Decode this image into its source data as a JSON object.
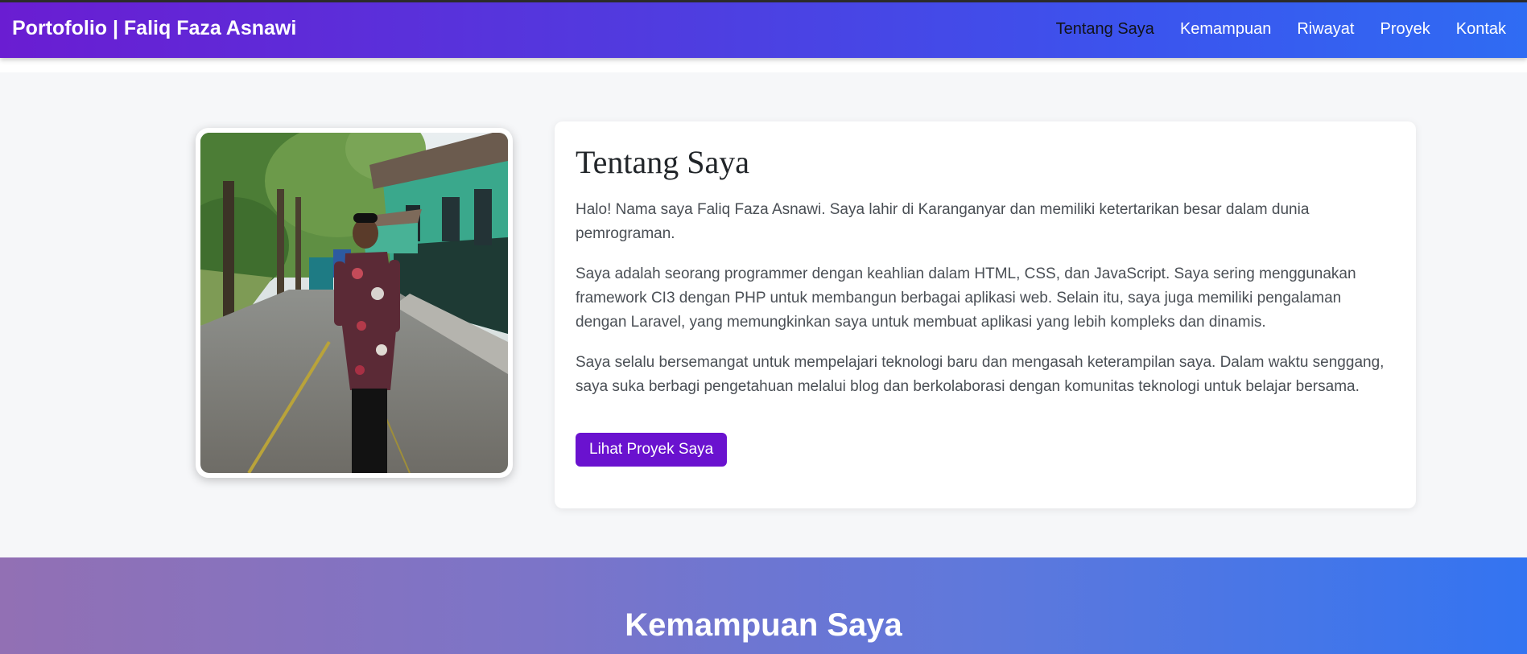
{
  "navbar": {
    "brand": "Portofolio | Faliq Faza Asnawi",
    "links": [
      {
        "label": "Tentang Saya",
        "active": true
      },
      {
        "label": "Kemampuan",
        "active": false
      },
      {
        "label": "Riwayat",
        "active": false
      },
      {
        "label": "Proyek",
        "active": false
      },
      {
        "label": "Kontak",
        "active": false
      }
    ],
    "colors": {
      "gradient_start": "#6a1dd2",
      "gradient_end": "#2f6cf3",
      "active_link": "#111318"
    }
  },
  "about": {
    "photo_icon": "profile-photo",
    "title": "Tentang Saya",
    "paragraphs": [
      "Halo! Nama saya Faliq Faza Asnawi. Saya lahir di Karanganyar dan memiliki ketertarikan besar dalam dunia pemrograman.",
      "Saya adalah seorang programmer dengan keahlian dalam HTML, CSS, dan JavaScript. Saya sering menggunakan framework CI3 dengan PHP untuk membangun berbagai aplikasi web. Selain itu, saya juga memiliki pengalaman dengan Laravel, yang memungkinkan saya untuk membuat aplikasi yang lebih kompleks dan dinamis.",
      "Saya selalu bersemangat untuk mempelajari teknologi baru dan mengasah keterampilan saya. Dalam waktu senggang, saya suka berbagi pengetahuan melalui blog dan berkolaborasi dengan komunitas teknologi untuk belajar bersama."
    ],
    "button_label": "Lihat Proyek Saya",
    "button_color": "#6a12cf"
  },
  "skills": {
    "title": "Kemampuan Saya"
  }
}
